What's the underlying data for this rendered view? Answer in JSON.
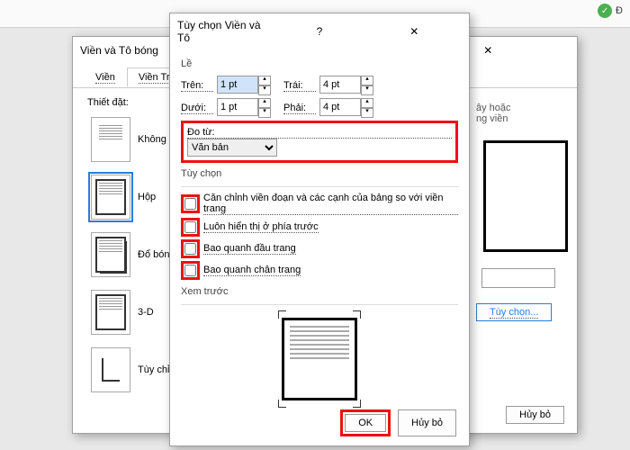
{
  "ribbon": {
    "status_label": "Đ"
  },
  "dialog_back": {
    "title": "Viền và Tô bóng",
    "tabs": [
      "Viền",
      "Viền Tr..."
    ],
    "left_label": "Thiết đặt:",
    "presets": {
      "none": "Không c",
      "box": "Hộp",
      "shadow": "Đổ bóng",
      "three_d": "3-D",
      "custom": "Tùy chỉnh"
    },
    "right_text1": "ây hoặc",
    "right_text2": "ng viền",
    "options_btn": "Tùy chọn...",
    "cancel": "Hủy bỏ"
  },
  "dialog_front": {
    "title": "Tùy chọn Viền và Tô",
    "margins_group": "Lề",
    "top_lbl": "Trên:",
    "bottom_lbl": "Dưới:",
    "left_lbl": "Trái:",
    "right_lbl": "Phải:",
    "top_val": "1 pt",
    "bottom_val": "1 pt",
    "left_val": "4 pt",
    "right_val": "4 pt",
    "measure_from_lbl": "Đo từ:",
    "measure_from_val": "Văn bản",
    "options_group": "Tùy chọn",
    "chk_align": "Căn chỉnh viền đoạn và các cạnh của bảng so với viền trang",
    "chk_front": "Luôn hiển thị ở phía trước",
    "chk_header": "Bao quanh đầu trang",
    "chk_footer": "Bao quanh chân trang",
    "preview_lbl": "Xem trước",
    "ok": "OK",
    "cancel": "Hủy bỏ"
  }
}
